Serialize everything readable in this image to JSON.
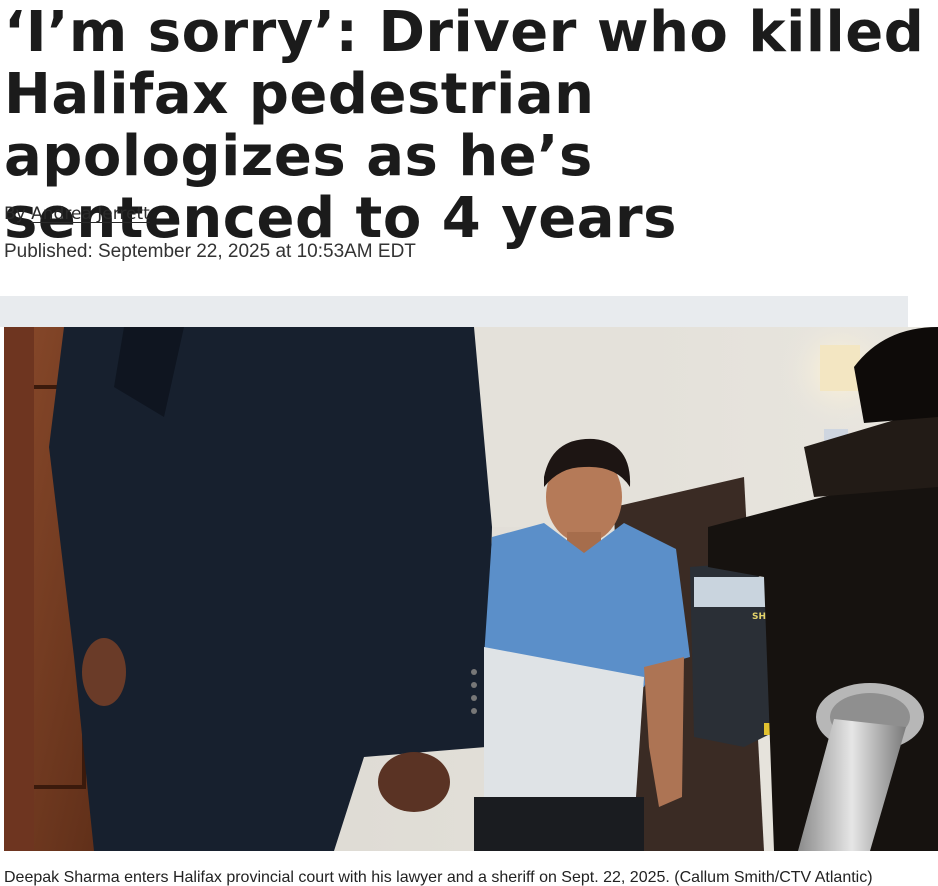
{
  "article": {
    "headline": "‘I’m sorry’: Driver who killed Halifax pedestrian apologizes as he’s sentenced to 4 years",
    "byline_prefix": "By",
    "author": "Andrea Jerrett",
    "published": "Published: September 22, 2025 at 10:53AM EDT"
  },
  "photo": {
    "badge_text": "SH",
    "caption": "Deepak Sharma enters Halifax provincial court with his lawyer and a sheriff on Sept. 22, 2025. (Callum Smith/CTV Atlantic)"
  }
}
